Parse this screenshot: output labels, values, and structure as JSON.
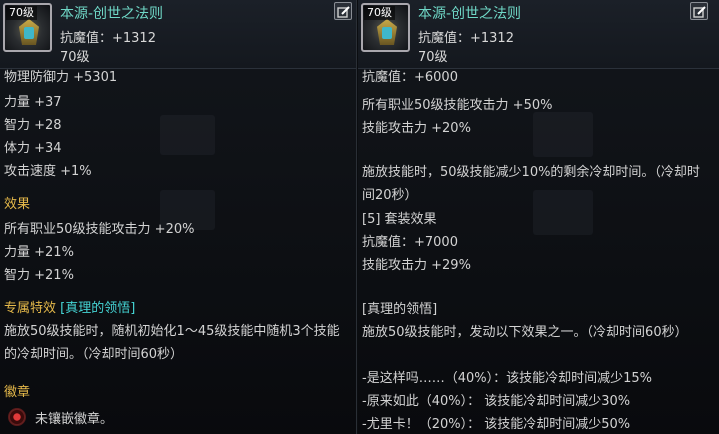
{
  "left": {
    "icon": "armor-icon",
    "level_tag": "70级",
    "name": "本源-创世之法则",
    "sub_stat": "抗魔值：+1312",
    "level": "70级",
    "lines": {
      "partial_top": "物理防御力 +5301",
      "str": "力量 +37",
      "int": "智力 +28",
      "vit": "体力 +34",
      "atk_speed": "攻击速度 +1%",
      "effect_title": "效果",
      "effect_1": "所有职业50级技能攻击力 +20%",
      "effect_2": "力量 +21%",
      "effect_3": "智力 +21%",
      "special_title": "专属特效",
      "special_name": "[真理的领悟]",
      "special_desc": "施放50级技能时，随机初始化1～45级技能中随机3个技能的冷却时间。（冷却时间60秒）",
      "emblem_title": "徽章",
      "emblem_text": "未镶嵌徽章。"
    }
  },
  "right": {
    "icon": "armor-icon",
    "level_tag": "70级",
    "name": "本源-创世之法则",
    "sub_stat": "抗魔值：+1312",
    "level": "70级",
    "lines": {
      "partial_top": "抗魔值：+6000",
      "l1": "所有职业50级技能攻击力 +50%",
      "l2": "技能攻击力 +20%",
      "l3": "施放技能时，50级技能减少10%的剩余冷却时间。（冷却时间20秒）",
      "l4": "[5] 套装效果",
      "l5": "抗魔值：+7000",
      "l6": "技能攻击力 +29%",
      "l7": "[真理的领悟]",
      "l8": "施放50级技能时，发动以下效果之一。（冷却时间60秒）",
      "l9": "-是这样吗……（40%）：该技能冷却时间减少15%",
      "l10": "-原来如此（40%）：  该技能冷却时间减少30%",
      "l11": "-尤里卡！（20%）：  该技能冷却时间减少50%"
    }
  }
}
